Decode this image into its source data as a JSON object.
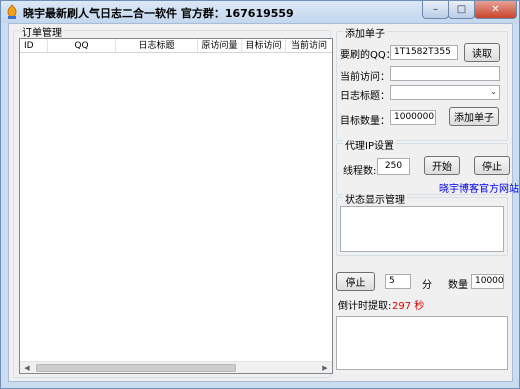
{
  "window": {
    "title": "晓宇最新刷人气日志二合一软件  官方群：167619559",
    "btn_min": "–",
    "btn_max": "□",
    "btn_close": "✕"
  },
  "orders": {
    "group_label": "订单管理",
    "columns": [
      "ID",
      "QQ",
      "日志标题",
      "原访问量",
      "目标访问",
      "当前访问"
    ],
    "rows": []
  },
  "add_order": {
    "group_label": "添加单子",
    "qq_label": "要刷的QQ：",
    "qq_value": "1T1582T355",
    "read_button": "读取",
    "current_visits_label": "当前访问：",
    "current_visits_value": "",
    "log_title_label": "日志标题：",
    "log_title_value": "",
    "target_qty_label": "目标数量：",
    "target_qty_value": "1000000",
    "add_button": "添加单子"
  },
  "proxy": {
    "group_label": "代理IP设置",
    "threads_label": "线程数:",
    "threads_value": "250",
    "start_button": "开始",
    "stop_button": "停止",
    "blog_link": "晓宇博客官方网站"
  },
  "status": {
    "group_label": "状态显示管理",
    "content": ""
  },
  "timer": {
    "stop_button": "停止",
    "minutes_value": "5",
    "minutes_unit": "分",
    "qty_label": "数量",
    "qty_value": "10000",
    "countdown_label": "倒计时提取:",
    "countdown_value": "297 秒",
    "log_content": ""
  },
  "colors": {
    "countdown": "#e00000",
    "link": "#0000ee",
    "close_button": "#c9432c"
  }
}
